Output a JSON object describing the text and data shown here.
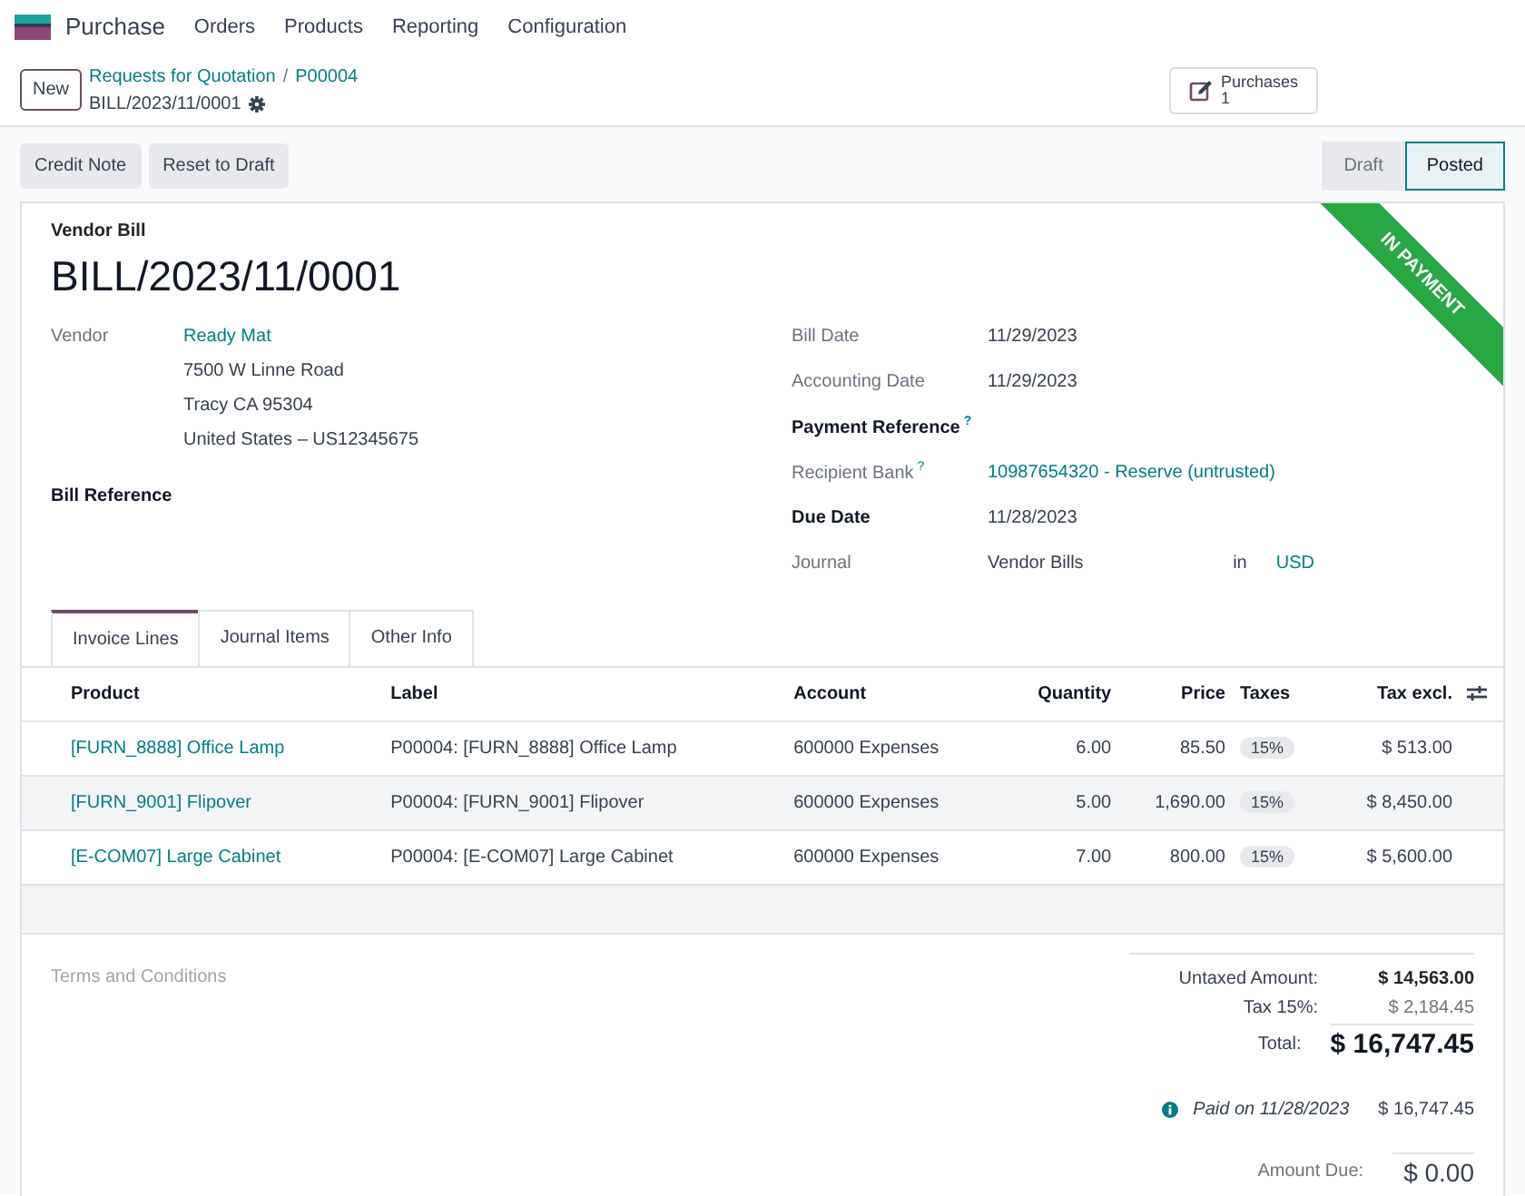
{
  "app": {
    "name": "Purchase",
    "menu": [
      "Orders",
      "Products",
      "Reporting",
      "Configuration"
    ]
  },
  "control_panel": {
    "new_button": "New",
    "breadcrumb": [
      "Requests for Quotation",
      "P00004"
    ],
    "breadcrumb_separator": "/",
    "record": "BILL/2023/11/0001",
    "smart_button": {
      "label": "Purchases",
      "count": "1"
    }
  },
  "actions": [
    "Credit Note",
    "Reset to Draft"
  ],
  "status_steps": [
    {
      "label": "Draft",
      "selected": false
    },
    {
      "label": "Posted",
      "selected": true
    }
  ],
  "ribbon": "IN PAYMENT",
  "form": {
    "subtitle": "Vendor Bill",
    "title": "BILL/2023/11/0001",
    "left_fields": [
      {
        "label": "Vendor",
        "bold": false,
        "link": "Ready Mat",
        "lines": [
          "7500 W Linne Road",
          "Tracy CA 95304",
          "United States – US12345675"
        ]
      },
      {
        "label": "Bill Reference",
        "bold": true
      }
    ],
    "right_fields": [
      {
        "label": "Bill Date",
        "bold": false,
        "value": "11/29/2023"
      },
      {
        "label": "Accounting Date",
        "bold": false,
        "value": "11/29/2023"
      },
      {
        "label": "Payment Reference",
        "bold": true,
        "help": "?"
      },
      {
        "label": "Recipient Bank",
        "bold": false,
        "help": "?",
        "link": "10987654320 - Reserve (untrusted)"
      },
      {
        "label": "Due Date",
        "bold": true,
        "value": "11/28/2023"
      },
      {
        "label": "Journal",
        "bold": false,
        "value": "Vendor Bills",
        "joiner": "in",
        "currency": "USD"
      }
    ]
  },
  "tabs": [
    {
      "label": "Invoice Lines",
      "selected": true
    },
    {
      "label": "Journal Items",
      "selected": false
    },
    {
      "label": "Other Info",
      "selected": false
    }
  ],
  "table": {
    "columns": [
      {
        "label": "Product",
        "kind": "text"
      },
      {
        "label": "Label",
        "kind": "text"
      },
      {
        "label": "Account",
        "kind": "text"
      },
      {
        "label": "Quantity",
        "kind": "number"
      },
      {
        "label": "Price",
        "kind": "number"
      },
      {
        "label": "Taxes",
        "kind": "tags"
      },
      {
        "label": "Tax excl.",
        "kind": "number"
      }
    ],
    "rows": [
      {
        "product": "[FURN_8888] Office Lamp",
        "label": "P00004: [FURN_8888] Office Lamp",
        "account": "600000 Expenses",
        "quantity": "6.00",
        "price": "85.50",
        "taxes": [
          "15%"
        ],
        "subtotal": "$ 513.00"
      },
      {
        "product": "[FURN_9001] Flipover",
        "label": "P00004: [FURN_9001] Flipover",
        "account": "600000 Expenses",
        "quantity": "5.00",
        "price": "1,690.00",
        "taxes": [
          "15%"
        ],
        "subtotal": "$ 8,450.00"
      },
      {
        "product": "[E-COM07] Large Cabinet",
        "label": "P00004: [E-COM07] Large Cabinet",
        "account": "600000 Expenses",
        "quantity": "7.00",
        "price": "800.00",
        "taxes": [
          "15%"
        ],
        "subtotal": "$ 5,600.00"
      }
    ]
  },
  "terms_placeholder": "Terms and Conditions",
  "totals": [
    {
      "label": "Untaxed Amount:",
      "value": "$ 14,563.00",
      "kind": "subtotal"
    },
    {
      "label": "Tax 15%:",
      "value": "$ 2,184.45",
      "kind": "tax"
    },
    {
      "label": "Total:",
      "value": "$ 16,747.45",
      "kind": "total"
    }
  ],
  "payments": [
    {
      "text": "Paid on 11/28/2023",
      "amount": "$ 16,747.45"
    }
  ],
  "amount_due": {
    "label": "Amount Due:",
    "value": "$ 0.00"
  }
}
